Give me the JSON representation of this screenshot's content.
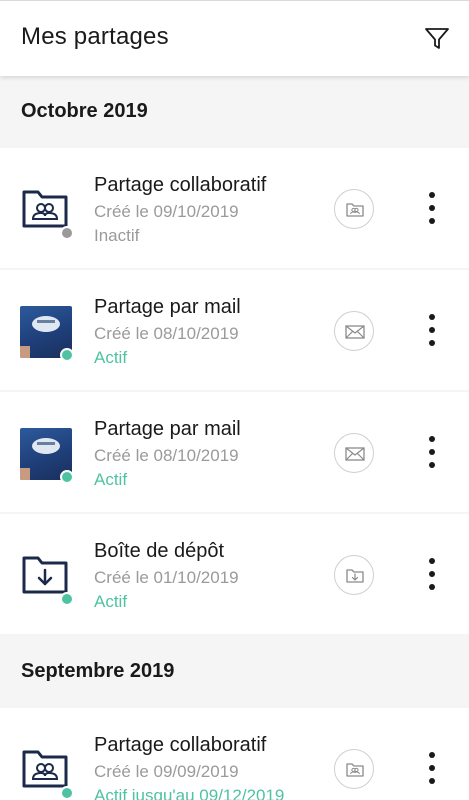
{
  "header": {
    "title": "Mes partages",
    "filter_icon": "filter-icon"
  },
  "colors": {
    "active": "#4fc3a1",
    "inactive": "#9a9a9a",
    "dot_inactive": "#9a9a9a",
    "icon_dark": "#1b2a4a"
  },
  "sections": [
    {
      "label": "Octobre 2019",
      "items": [
        {
          "name": "Partage collaboratif",
          "date": "Créé le 09/10/2019",
          "status": "Inactif",
          "thumb": "collab-folder-icon",
          "type_icon": "collab-folder-icon"
        },
        {
          "name": "Partage par mail",
          "date": "Créé le 08/10/2019",
          "status": "Actif",
          "thumb": "photo-thumbnail",
          "type_icon": "mail-icon"
        },
        {
          "name": "Partage par mail",
          "date": "Créé le 08/10/2019",
          "status": "Actif",
          "thumb": "photo-thumbnail",
          "type_icon": "mail-icon"
        },
        {
          "name": "Boîte de dépôt",
          "date": "Créé le 01/10/2019",
          "status": "Actif",
          "thumb": "dropbox-folder-icon",
          "type_icon": "dropbox-folder-icon"
        }
      ]
    },
    {
      "label": "Septembre 2019",
      "items": [
        {
          "name": "Partage collaboratif",
          "date": "Créé le 09/09/2019",
          "status": "Actif jusqu'au 09/12/2019",
          "thumb": "collab-folder-icon",
          "type_icon": "collab-folder-icon"
        }
      ]
    }
  ]
}
